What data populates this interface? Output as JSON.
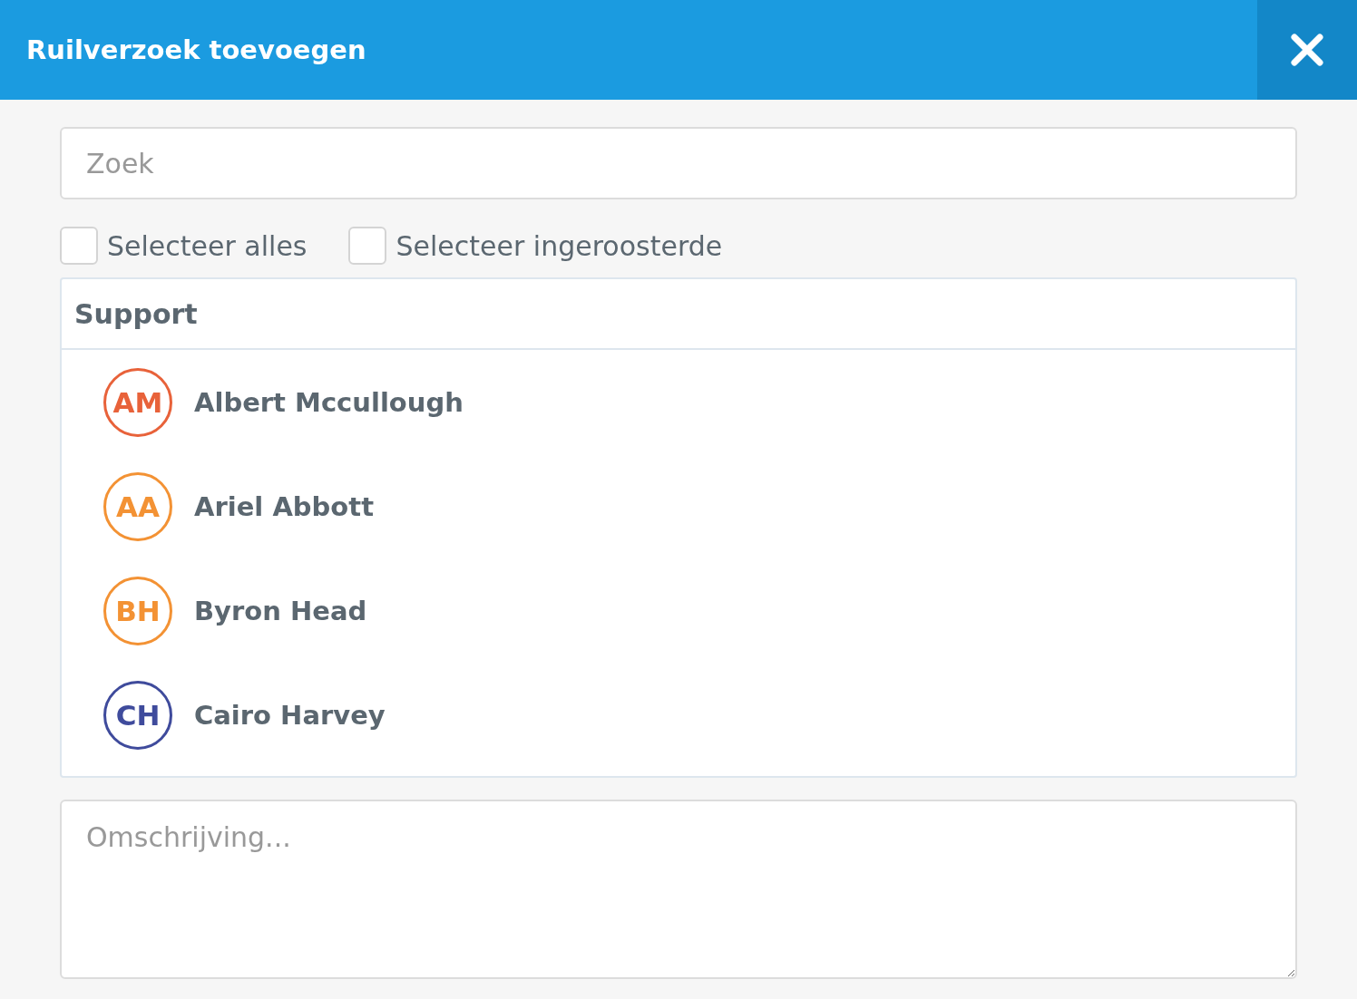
{
  "window": {
    "title": "Ruilverzoek toevoegen"
  },
  "search": {
    "placeholder": "Zoek"
  },
  "filters": [
    {
      "label": "Selecteer alles",
      "checked": false
    },
    {
      "label": "Selecteer ingeroosterde",
      "checked": false
    }
  ],
  "group": {
    "title": "Support",
    "members": [
      {
        "initials": "AM",
        "name": "Albert Mccullough",
        "color": "#e8623a"
      },
      {
        "initials": "AA",
        "name": "Ariel Abbott",
        "color": "#f39234"
      },
      {
        "initials": "BH",
        "name": "Byron Head",
        "color": "#f39234"
      },
      {
        "initials": "CH",
        "name": "Cairo Harvey",
        "color": "#3f4b9c"
      }
    ]
  },
  "description": {
    "placeholder": "Omschrijving..."
  }
}
